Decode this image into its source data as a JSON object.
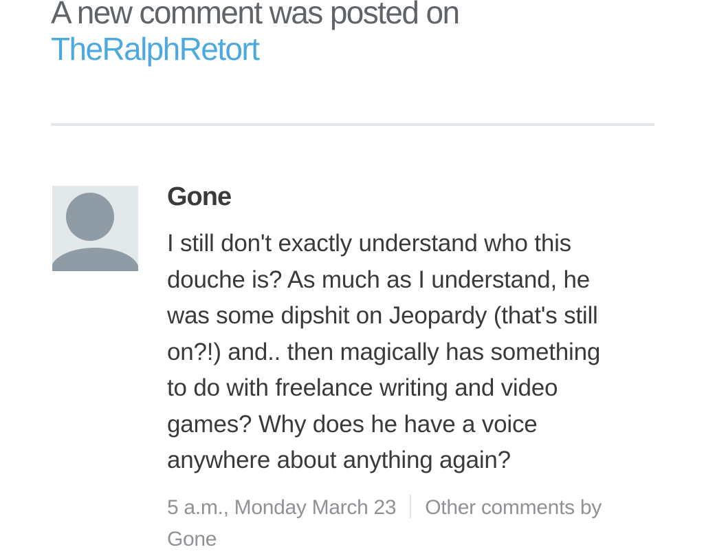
{
  "header": {
    "prefix": "A new comment was posted on",
    "site_name": "TheRalphRetort"
  },
  "comment": {
    "author": "Gone",
    "avatar_icon": "default-avatar-icon",
    "body_lines": [
      "I still don't exactly understand who this",
      "douche is? As much as I understand, he",
      "was some dipshit on Jeopardy (that's still",
      "on?!) and.. then magically has something",
      "to do with freelance writing and video",
      "games? Why does he have a voice",
      "anywhere about anything again?"
    ],
    "timestamp": "5 a.m., Monday March 23",
    "other_comments_label": "Other comments by",
    "other_comments_author": "Gone"
  },
  "colors": {
    "link": "#4ba9de",
    "heading": "#5f6468",
    "meta": "#8e9296",
    "divider": "#e5e8eb",
    "avatar_bg": "#e3e8ea",
    "avatar_fg": "#8f9ca5"
  }
}
